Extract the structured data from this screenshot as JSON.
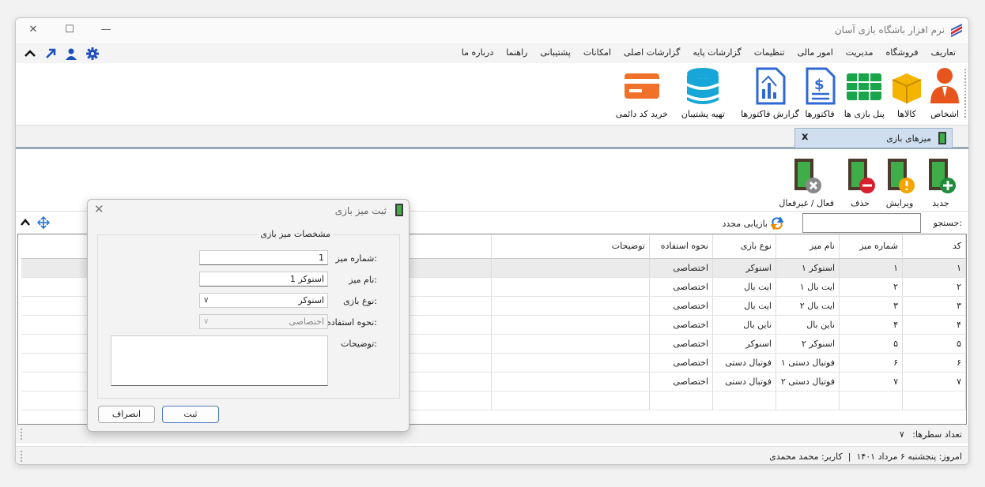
{
  "window": {
    "title": "نرم افزار باشگاه بازی آسان"
  },
  "menu": [
    "تعاریف",
    "فروشگاه",
    "مدیریت",
    "امور مالی",
    "تنظیمات",
    "گزارشات پایه",
    "گزارشات اصلی",
    "امکانات",
    "پشتیبانی",
    "راهنما",
    "درباره ما"
  ],
  "ribbon": {
    "persons": "اشخاص",
    "goods": "کالاها",
    "game_panel": "پنل بازی ها",
    "invoices": "فاکتورها",
    "invoice_report": "گزارش فاکتورها",
    "backup": "تهیه پشتیبان",
    "buy_code": "خرید کد دائمی"
  },
  "tab": {
    "label": "میزهای بازی",
    "close": "x"
  },
  "toolbar": {
    "new": "جدید",
    "edit": "ویرایش",
    "delete": "حذف",
    "toggle": "فعال / غیرفعال"
  },
  "search": {
    "label": "جستجو:",
    "value": "",
    "refresh": "بازیابی مجدد"
  },
  "grid": {
    "headers": [
      "کد",
      "شماره میز",
      "نام میز",
      "نوع بازی",
      "نحوه استفاده",
      "توضیحات"
    ],
    "rows": [
      [
        "۱",
        "۱",
        "اسنوکر ۱",
        "اسنوکر",
        "اختصاصی",
        ""
      ],
      [
        "۲",
        "۲",
        "ایت بال ۱",
        "ایت بال",
        "اختصاصی",
        ""
      ],
      [
        "۳",
        "۳",
        "ایت بال ۲",
        "ایت بال",
        "اختصاصی",
        ""
      ],
      [
        "۴",
        "۴",
        "ناین بال",
        "ناین بال",
        "اختصاصی",
        ""
      ],
      [
        "۵",
        "۵",
        "اسنوکر ۲",
        "اسنوکر",
        "اختصاصی",
        ""
      ],
      [
        "۶",
        "۶",
        "فوتبال دستی ۱",
        "فوتبال دستی",
        "اختصاصی",
        ""
      ],
      [
        "۷",
        "۷",
        "فوتبال دستی ۲",
        "فوتبال دستی",
        "اختصاصی",
        ""
      ]
    ]
  },
  "status": {
    "row_count_label": "تعداد سطرها:",
    "row_count": "۷",
    "today": "امروز: پنجشنبه ۶ مرداد ۱۴۰۱",
    "user": "کاربر: محمد محمدی"
  },
  "dialog": {
    "title": "ثبت میز بازی",
    "group": "مشخصات میز بازی",
    "table_no_label": "شماره میز:",
    "table_no_value": "1",
    "name_label": "نام میز:",
    "name_value": "اسنوکر 1",
    "game_type_label": "نوع بازی:",
    "game_type_value": "اسنوکر",
    "usage_label": "نحوه استفاده:",
    "usage_value": "اختصاصی",
    "desc_label": "توضیحات:",
    "desc_value": "",
    "save": "ثبت",
    "cancel": "انصراف"
  },
  "colors": {
    "accent": "#1f4fbf",
    "tab": "#cfdfef",
    "green": "#1e8c3a"
  }
}
